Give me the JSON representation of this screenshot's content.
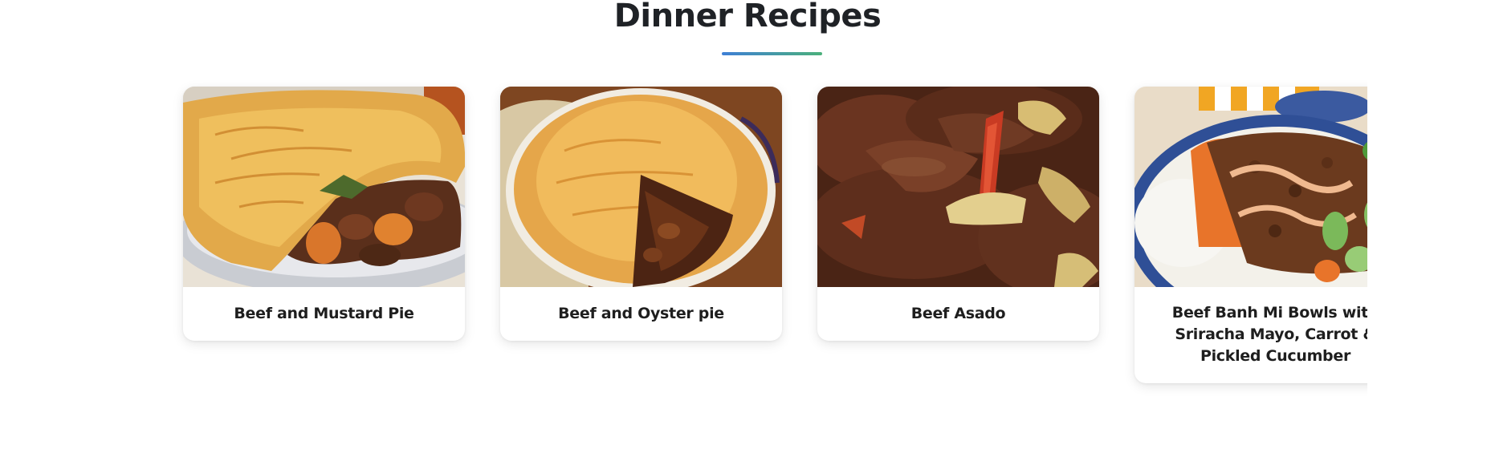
{
  "section": {
    "title": "Dinner Recipes"
  },
  "colors": {
    "underline_start": "#3e7fd6",
    "underline_end": "#4bb07b",
    "card_background": "#ffffff",
    "title_text": "#1f2226"
  },
  "recipes": [
    {
      "title": "Beef and Mustard Pie",
      "image_icon": "pie-photo"
    },
    {
      "title": "Beef and Oyster pie",
      "image_icon": "pie-photo"
    },
    {
      "title": "Beef Asado",
      "image_icon": "stew-photo"
    },
    {
      "title": "Beef Banh Mi Bowls with Sriracha Mayo, Carrot & Pickled Cucumber",
      "image_icon": "bowl-photo"
    }
  ]
}
